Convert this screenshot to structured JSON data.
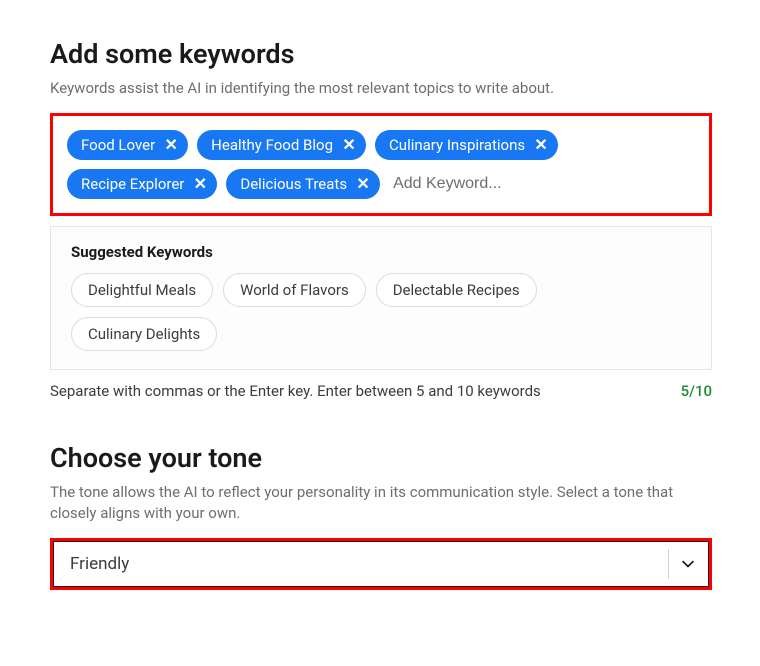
{
  "keywords": {
    "title": "Add some keywords",
    "description": "Keywords assist the AI in identifying the most relevant topics to write about.",
    "tags": [
      "Food Lover",
      "Healthy Food Blog",
      "Culinary Inspirations",
      "Recipe Explorer",
      "Delicious Treats"
    ],
    "placeholder": "Add Keyword...",
    "suggested_title": "Suggested Keywords",
    "suggested": [
      "Delightful Meals",
      "World of Flavors",
      "Delectable Recipes",
      "Culinary Delights"
    ],
    "hint": "Separate with commas or the Enter key. Enter between 5 and 10 keywords",
    "count": "5/10"
  },
  "tone": {
    "title": "Choose your tone",
    "description": "The tone allows the AI to reflect your personality in its communication style. Select a tone that closely aligns with your own.",
    "selected": "Friendly"
  }
}
